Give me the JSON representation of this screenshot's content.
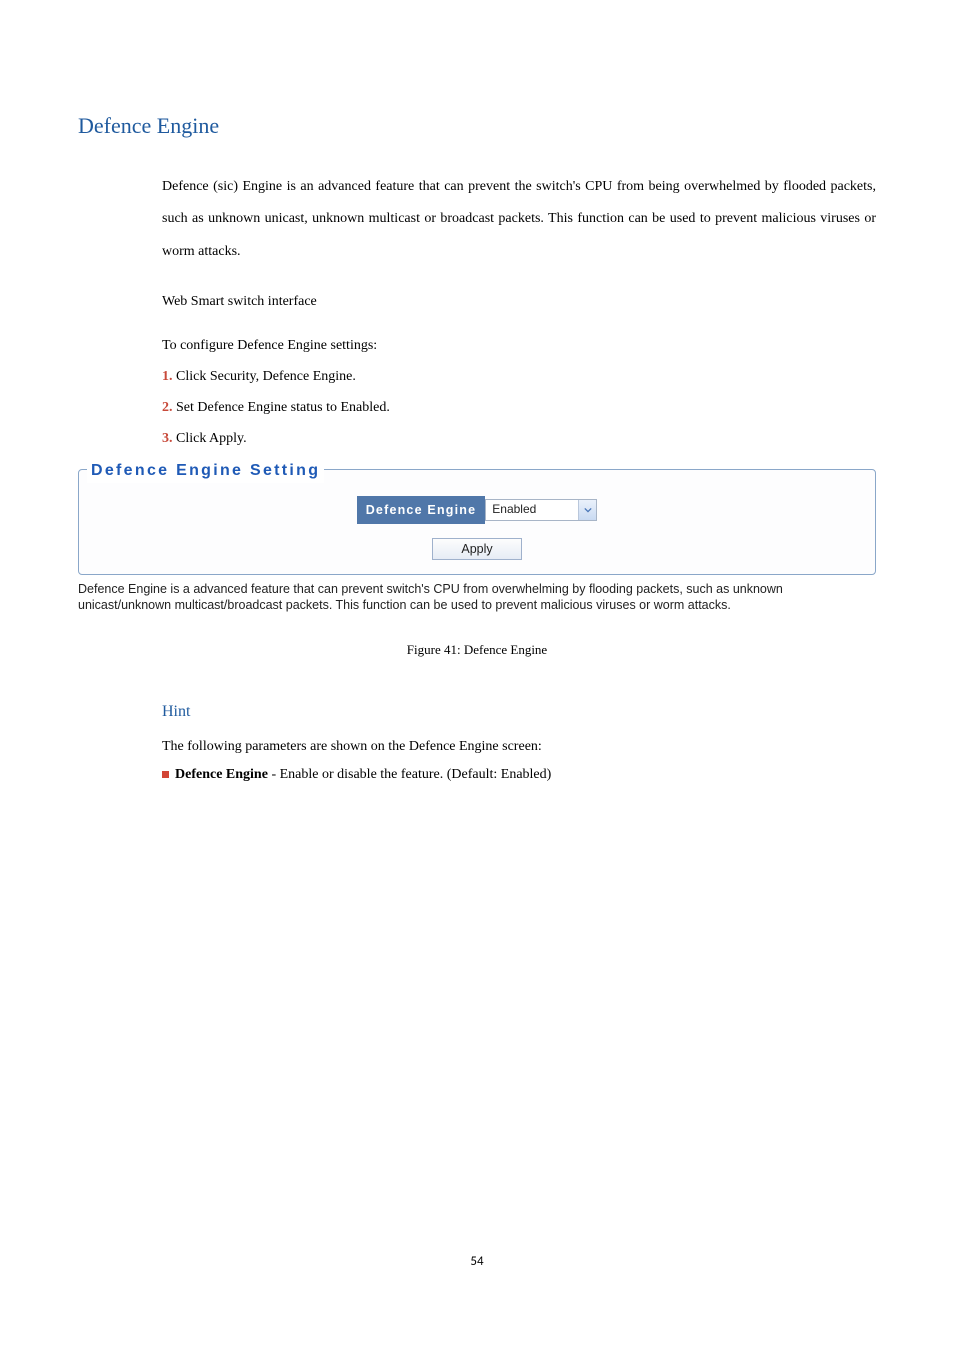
{
  "doc": {
    "section_title": "Defence Engine",
    "intro_paragraph": "Defence (sic) Engine is an advanced feature that can prevent the switch's CPU from being overwhelmed by flooded packets, such as unknown unicast, unknown multicast or broadcast packets. This function can be used to prevent malicious viruses or worm attacks.",
    "interface_label": "Web Smart switch interface",
    "config_intro": "To configure Defence Engine settings:",
    "steps": {
      "s1_num": "1.",
      "s1_text": " Click Security, Defence Engine.",
      "s2_num": "2.",
      "s2_text": " Set Defence Engine status to Enabled.",
      "s3_num": "3.",
      "s3_text": " Click Apply."
    },
    "figure_caption": "Figure 41: Defence Engine",
    "hint_title": "Hint",
    "hint_body": "The following parameters are shown on the Defence Engine screen:",
    "hint_item_bold": "Defence Engine",
    "hint_item_rest": " - Enable or disable the feature. (Default: Enabled)",
    "page_number": "54"
  },
  "screenshot": {
    "legend": "Defence Engine Setting",
    "field_label": "Defence Engine",
    "dropdown_value": "Enabled",
    "apply_label": "Apply",
    "caption_text": "Defence Engine is a advanced feature that can prevent switch's CPU from overwhelming by flooding packets, such as unknown unicast/unknown multicast/broadcast packets. This function can be used to prevent malicious viruses or worm attacks."
  }
}
